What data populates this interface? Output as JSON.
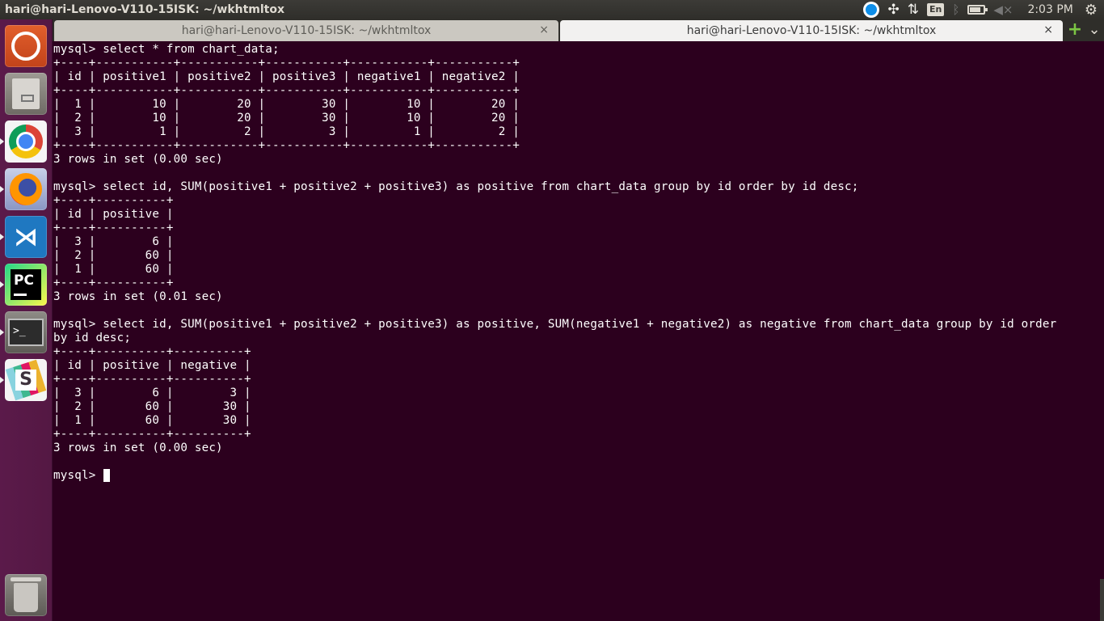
{
  "topbar": {
    "title": "hari@hari-Lenovo-V110-15ISK: ~/wkhtmltox",
    "keyboard_layout": "En",
    "clock": "2:03 PM",
    "icons": [
      "teamviewer-icon",
      "network-icon",
      "transfer-arrows-icon",
      "keyboard-layout-indicator",
      "bluetooth-icon",
      "battery-icon",
      "volume-muted-icon",
      "settings-gear-icon"
    ]
  },
  "launcher": {
    "items": [
      "Ubuntu Dash",
      "Files",
      "Google Chrome",
      "Firefox",
      "Visual Studio Code",
      "PyCharm",
      "Terminal",
      "Slack",
      "Trash"
    ]
  },
  "tabs": [
    {
      "label": "hari@hari-Lenovo-V110-15ISK: ~/wkhtmltox",
      "active": false,
      "close": "×"
    },
    {
      "label": "hari@hari-Lenovo-V110-15ISK: ~/wkhtmltox",
      "active": true,
      "close": "×"
    }
  ],
  "terminal": {
    "background": "#2c001e",
    "foreground": "#ffffff",
    "lines": [
      "mysql> select * from chart_data;",
      "+----+-----------+-----------+-----------+-----------+-----------+",
      "| id | positive1 | positive2 | positive3 | negative1 | negative2 |",
      "+----+-----------+-----------+-----------+-----------+-----------+",
      "|  1 |        10 |        20 |        30 |        10 |        20 |",
      "|  2 |        10 |        20 |        30 |        10 |        20 |",
      "|  3 |         1 |         2 |         3 |         1 |         2 |",
      "+----+-----------+-----------+-----------+-----------+-----------+",
      "3 rows in set (0.00 sec)",
      "",
      "mysql> select id, SUM(positive1 + positive2 + positive3) as positive from chart_data group by id order by id desc;",
      "+----+----------+",
      "| id | positive |",
      "+----+----------+",
      "|  3 |        6 |",
      "|  2 |       60 |",
      "|  1 |       60 |",
      "+----+----------+",
      "3 rows in set (0.01 sec)",
      "",
      "mysql> select id, SUM(positive1 + positive2 + positive3) as positive, SUM(negative1 + negative2) as negative from chart_data group by id order",
      "by id desc;",
      "+----+----------+----------+",
      "| id | positive | negative |",
      "+----+----------+----------+",
      "|  3 |        6 |        3 |",
      "|  2 |       60 |       30 |",
      "|  1 |       60 |       30 |",
      "+----+----------+----------+",
      "3 rows in set (0.00 sec)",
      "",
      "mysql> "
    ]
  }
}
